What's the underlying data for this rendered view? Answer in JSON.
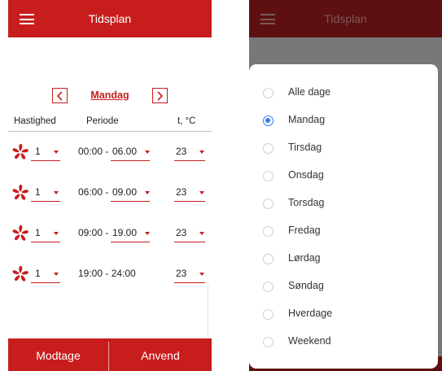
{
  "left_screen": {
    "header": {
      "title": "Tidsplan"
    },
    "day_nav": {
      "day": "Mandag"
    },
    "columns": {
      "speed": "Hastighed",
      "period": "Periode",
      "temp": "t, °C"
    },
    "rows": [
      {
        "speed": "1",
        "start": "00:00 - ",
        "end": "06.00",
        "temp": "23"
      },
      {
        "speed": "1",
        "start": "06:00 - ",
        "end": "09.00",
        "temp": "23"
      },
      {
        "speed": "1",
        "start": "09:00 - ",
        "end": "19.00",
        "temp": "23"
      },
      {
        "speed": "1",
        "period_fixed": "19:00 - 24:00",
        "temp": "23"
      }
    ],
    "footer": {
      "receive": "Modtage",
      "apply": "Anvend"
    }
  },
  "right_screen": {
    "header": {
      "title": "Tidsplan"
    },
    "day_picker": {
      "selected": "Mandag",
      "options": [
        "Alle dage",
        "Mandag",
        "Tirsdag",
        "Onsdag",
        "Torsdag",
        "Fredag",
        "Lørdag",
        "Søndag",
        "Hverdage",
        "Weekend"
      ]
    }
  },
  "colors": {
    "accent": "#c81d1d",
    "radio_selected": "#2f7bf5",
    "dimmed_bar": "#5e1010",
    "overlay": "#787878"
  },
  "icons": [
    "menu-icon",
    "chevron-left-icon",
    "chevron-right-icon",
    "fan-icon",
    "dropdown-caret-icon",
    "radio-icon"
  ]
}
